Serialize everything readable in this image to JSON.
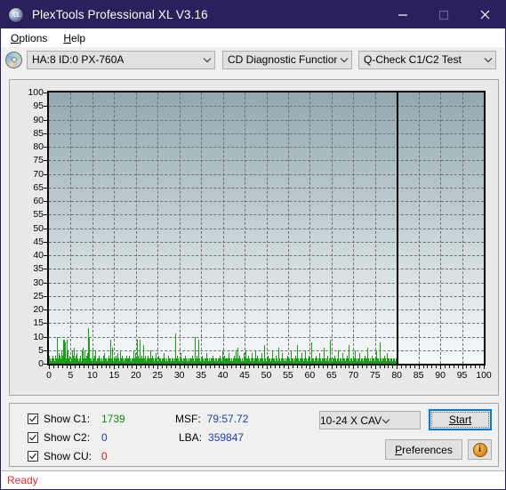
{
  "window": {
    "title": "PlexTools Professional XL V3.16",
    "app_icon": "disc-xl-icon",
    "minimize_label": "–",
    "maximize_label": "□",
    "close_label": "✕",
    "titlebar_color": "#2b1f5d"
  },
  "menu": {
    "items": [
      {
        "label": "Options",
        "accel": "O"
      },
      {
        "label": "Help",
        "accel": "H"
      }
    ]
  },
  "toolbar": {
    "drive_icon": "cd-disc-icon",
    "drive_combo": {
      "value": "HA:8 ID:0  PX-760A"
    },
    "function_combo": {
      "value": "CD Diagnostic Functions"
    },
    "test_combo": {
      "value": "Q-Check C1/C2 Test"
    }
  },
  "chart_data": {
    "type": "bar",
    "title": "",
    "xlabel": "",
    "ylabel": "",
    "xlim": [
      0,
      100
    ],
    "ylim": [
      0,
      100
    ],
    "x_ticks": [
      0,
      5,
      10,
      15,
      20,
      25,
      30,
      35,
      40,
      45,
      50,
      55,
      60,
      65,
      70,
      75,
      80,
      85,
      90,
      95,
      100
    ],
    "y_ticks": [
      0,
      5,
      10,
      15,
      20,
      25,
      30,
      35,
      40,
      45,
      50,
      55,
      60,
      65,
      70,
      75,
      80,
      85,
      90,
      95,
      100
    ],
    "grid": true,
    "legend": "none",
    "series": [
      {
        "name": "C1",
        "color": "#16a016",
        "x_end": 80,
        "values": [
          3,
          1,
          2,
          1,
          1,
          2,
          1,
          3,
          1,
          1,
          2,
          1,
          1,
          2,
          3,
          1,
          2,
          1,
          10,
          1,
          2,
          4,
          1,
          3,
          2,
          1,
          5,
          2,
          3,
          1,
          9,
          2,
          1,
          9,
          3,
          8,
          1,
          2,
          9,
          2,
          1,
          5,
          2,
          1,
          3,
          2,
          1,
          2,
          1,
          2,
          5,
          2,
          3,
          1,
          6,
          1,
          2,
          3,
          1,
          4,
          1,
          2,
          1,
          1,
          1,
          2,
          1,
          1,
          3,
          1,
          5,
          1,
          2,
          6,
          2,
          1,
          5,
          1,
          2,
          1,
          3,
          1,
          2,
          4,
          13,
          2,
          1,
          10,
          2,
          1,
          1,
          2,
          1,
          6,
          1,
          2,
          1,
          3,
          1,
          2,
          5,
          1,
          1,
          2,
          1,
          2,
          1,
          3,
          1,
          1,
          2,
          1,
          1,
          2,
          1,
          1,
          2,
          3,
          1,
          4,
          1,
          2,
          1,
          2,
          1,
          1,
          2,
          1,
          3,
          1,
          2,
          1,
          9,
          1,
          2,
          1,
          2,
          6,
          1,
          2,
          1,
          1,
          2,
          1,
          3,
          1,
          2,
          1,
          4,
          1,
          2,
          1,
          1,
          5,
          1,
          2,
          1,
          1,
          3,
          1,
          2,
          1,
          1,
          2,
          1,
          2,
          3,
          1,
          2,
          1,
          2,
          1,
          3,
          1,
          1,
          2,
          1,
          1,
          2,
          1,
          2,
          1,
          5,
          1,
          2,
          1,
          4,
          2,
          1,
          9,
          2,
          1,
          3,
          1,
          2,
          1,
          9,
          1,
          2,
          1,
          3,
          1,
          2,
          1,
          7,
          2,
          1,
          2,
          3,
          1,
          2,
          1,
          3,
          1,
          2,
          1,
          1,
          2,
          1,
          5,
          1,
          2,
          1,
          3,
          1,
          2,
          1,
          1,
          2,
          1,
          4,
          1,
          2,
          1,
          1,
          3,
          1,
          2,
          1,
          1,
          2,
          1,
          1,
          2,
          1,
          1,
          2,
          1,
          4,
          1,
          2,
          1,
          1,
          2,
          1,
          1,
          3,
          1,
          2,
          1,
          1,
          2,
          1,
          1,
          2,
          1,
          1,
          2,
          1,
          1,
          2,
          1,
          11,
          1,
          2,
          1,
          3,
          1,
          2,
          1,
          1,
          2,
          1,
          1,
          4,
          1,
          2,
          1,
          1,
          2,
          1,
          1,
          2,
          1,
          3,
          1,
          2,
          1,
          1,
          2,
          1,
          1,
          2,
          1,
          2,
          1,
          1,
          2,
          1,
          3,
          1,
          2,
          1,
          1,
          10,
          1,
          2,
          1,
          3,
          1,
          2,
          1,
          9,
          1,
          2,
          1,
          1,
          2,
          1,
          1,
          3,
          1,
          2,
          1,
          1,
          2,
          1,
          1,
          2,
          1,
          4,
          1,
          2,
          1,
          1,
          2,
          1,
          1,
          2,
          1,
          1,
          2,
          1,
          3,
          1,
          2,
          1,
          1,
          2,
          1,
          1,
          2,
          1,
          1,
          2,
          1,
          2,
          1,
          3,
          1,
          2,
          1,
          1,
          5,
          1,
          2,
          1,
          3,
          1,
          2,
          1,
          1,
          2,
          1,
          2,
          1,
          2,
          1,
          4,
          1,
          2,
          1,
          1,
          2,
          1,
          1,
          2,
          1,
          3,
          1,
          2,
          1,
          5,
          1,
          2,
          1,
          1,
          6,
          1,
          2,
          1,
          3,
          1,
          2,
          1,
          1,
          2,
          1,
          1,
          4,
          1,
          2,
          1,
          5,
          1,
          2,
          1,
          1,
          2,
          1,
          3,
          1,
          2,
          1,
          1,
          2,
          1,
          4,
          1,
          2,
          1,
          1,
          2,
          1,
          1,
          5,
          1,
          2,
          1,
          3,
          1,
          2,
          1,
          1,
          2,
          1,
          1,
          2,
          1,
          4,
          1,
          2,
          1,
          1,
          7,
          1,
          2,
          1,
          1,
          2,
          1,
          3,
          1,
          2,
          1,
          1,
          2,
          1,
          1,
          2,
          1,
          5,
          1,
          2,
          1,
          1,
          2,
          1,
          1,
          3,
          1,
          2,
          1,
          1,
          2,
          6,
          1,
          2,
          1,
          1,
          2,
          1,
          1,
          4,
          1,
          2,
          1,
          1,
          2,
          1,
          1,
          2,
          1,
          3,
          1,
          2,
          1,
          1,
          2,
          1,
          1,
          5,
          1,
          2,
          1,
          1,
          2,
          1,
          1,
          2,
          1,
          3,
          1,
          2,
          1,
          7,
          1,
          2,
          1,
          1,
          2,
          1,
          1,
          2,
          1,
          4,
          1,
          2,
          1,
          1,
          2,
          1,
          1,
          5,
          1,
          2,
          1,
          1,
          2,
          1,
          3,
          1,
          2,
          1,
          1,
          8,
          1,
          2,
          1,
          1,
          2,
          1,
          1,
          2,
          1,
          3,
          1,
          2,
          1,
          1,
          2,
          1,
          1,
          4,
          1,
          2,
          1,
          1,
          2,
          1,
          1,
          2,
          1,
          6,
          1,
          2,
          1,
          1,
          2,
          1,
          1,
          3,
          1,
          2,
          1,
          1,
          9,
          1,
          2,
          1,
          1,
          2,
          1,
          1,
          2,
          1,
          3,
          1,
          2,
          1,
          1,
          2,
          1,
          1,
          5,
          1,
          2,
          1,
          1,
          2,
          1,
          1,
          4,
          1,
          2,
          1,
          1,
          2,
          1,
          1,
          2,
          1,
          3,
          1,
          2,
          1,
          1,
          7,
          1,
          2,
          1,
          1,
          2,
          1,
          1,
          3,
          1,
          2,
          1,
          1,
          5,
          1,
          2,
          1,
          1,
          2,
          1,
          1,
          2,
          1,
          4,
          1,
          2,
          1,
          1,
          2,
          1,
          1,
          2,
          1,
          3,
          1,
          2,
          1,
          1,
          2,
          1,
          6,
          1,
          2,
          1,
          1,
          2,
          1,
          1,
          3,
          1,
          2,
          1,
          1,
          2,
          1,
          1,
          2,
          1,
          5,
          1,
          2,
          1,
          1,
          2,
          1,
          1,
          8,
          1,
          2,
          1,
          1,
          2,
          1,
          1,
          2,
          1,
          3,
          1,
          2,
          1,
          1,
          4,
          1,
          2,
          1,
          1,
          2,
          1,
          1,
          2,
          1,
          2,
          1,
          1,
          2,
          1,
          1,
          2,
          1,
          1,
          2,
          1,
          1
        ]
      }
    ]
  },
  "stats": {
    "checkboxes": [
      {
        "label": "Show C1:",
        "value": "1739",
        "color": "#129212",
        "checked": true
      },
      {
        "label": "Show C2:",
        "value": "0",
        "color": "#1f3fa0",
        "checked": true
      },
      {
        "label": "Show CU:",
        "value": "0",
        "color": "#d02020",
        "checked": true
      }
    ],
    "msf": {
      "label": "MSF:",
      "value": "79:57.72"
    },
    "lba": {
      "label": "LBA:",
      "value": "359847"
    }
  },
  "controls": {
    "speed_combo": {
      "value": "10-24 X CAV"
    },
    "start_button": {
      "label": "Start",
      "accel": "S"
    },
    "preferences_button": {
      "label": "Preferences",
      "accel": "P"
    },
    "info_button": {
      "label": "i",
      "icon": "info-icon"
    }
  },
  "statusbar": {
    "text": "Ready",
    "color": "#e03030"
  }
}
